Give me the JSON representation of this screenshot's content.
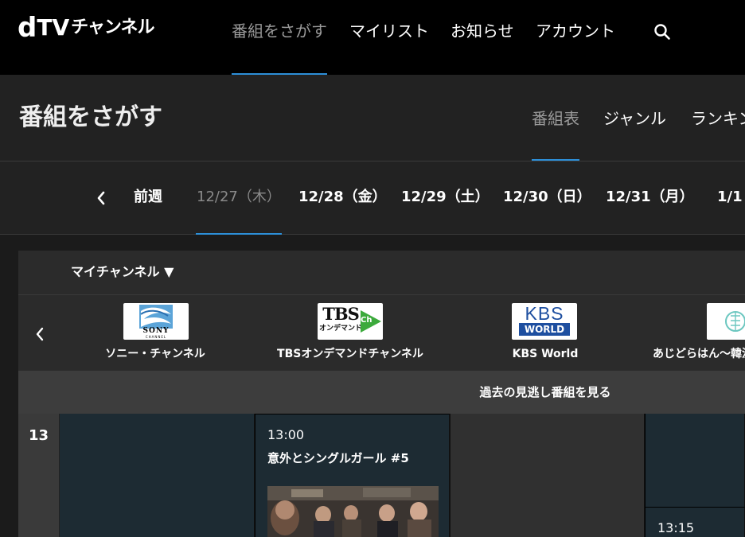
{
  "brand": {
    "d": "d",
    "tv": "TV",
    "channel": "チャンネル"
  },
  "nav": {
    "items": [
      "番組をさがす",
      "マイリスト",
      "お知らせ",
      "アカウント"
    ],
    "active_index": 0
  },
  "section": {
    "title": "番組をさがす",
    "tabs": [
      "番組表",
      "ジャンル",
      "ランキン"
    ]
  },
  "dates": {
    "prev_label": "前週",
    "days": [
      "12/27（木）",
      "12/28（金）",
      "12/29（土）",
      "12/30（日）",
      "12/31（月）",
      "1/1"
    ]
  },
  "guide": {
    "my_channel_label": "マイチャンネル ▼",
    "channels": [
      {
        "name": "ソニー・チャンネル",
        "logo_text": "SONY",
        "logo_sub": "CHANNEL"
      },
      {
        "name": "TBSオンデマンドチャンネル",
        "logo_text": "TBS",
        "logo_sub": "オンデマンド",
        "logo_badge": "Ch"
      },
      {
        "name": "KBS World",
        "logo_text": "KBS",
        "logo_sub": "WORLD"
      },
      {
        "name": "あじどらはん〜韓流"
      }
    ],
    "past_label": "過去の見逃し番組を見る",
    "hour": "13",
    "programs": [
      {
        "time": "13:00",
        "title": "意外とシングルガール #5"
      },
      {
        "time": "13:15"
      }
    ]
  },
  "colors": {
    "accent": "#2d8fd8",
    "cell_dark": "#1d2b33",
    "cell_grey": "#303030"
  }
}
